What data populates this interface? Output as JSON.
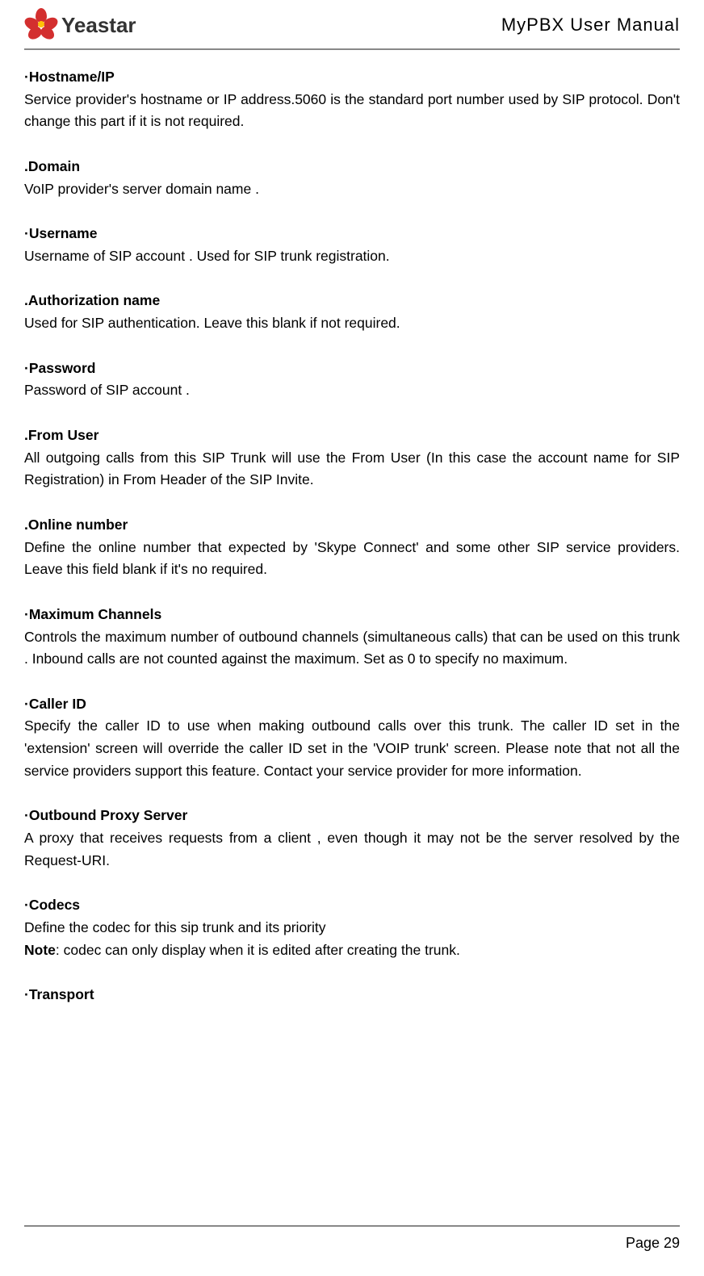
{
  "header": {
    "brand": "Yeastar",
    "doc_title": "MyPBX User Manual"
  },
  "sections": [
    {
      "title": "·Hostname/IP",
      "body": "Service provider's hostname or IP address.5060 is the standard port number used by SIP protocol. Don't change this part if it is not required."
    },
    {
      "title": ".Domain",
      "body": "VoIP provider's server domain name ."
    },
    {
      "title": "·Username",
      "body": "Username of SIP account . Used for SIP trunk registration."
    },
    {
      "title": ".Authorization name",
      "body": "Used for SIP authentication. Leave this blank if not required."
    },
    {
      "title": "·Password",
      "body": "Password of SIP account ."
    },
    {
      "title": ".From User",
      "body": "All outgoing calls from this SIP Trunk will use the From User (In this case the account name for SIP Registration) in From Header of the SIP Invite."
    },
    {
      "title": ".Online number",
      "body": "Define the online number that expected by 'Skype Connect' and some other SIP service providers. Leave this field blank if it's no required."
    },
    {
      "title": "·Maximum Channels",
      "body": "Controls the maximum number of outbound channels (simultaneous calls) that can be used on this trunk . Inbound calls are not counted against the maximum. Set as 0 to specify no maximum."
    },
    {
      "title": "·Caller ID",
      "body": "Specify the caller ID to use when making outbound calls over this trunk. The caller ID set in the 'extension' screen will override the caller ID set in the 'VOIP trunk' screen. Please note that not all the service providers support this feature. Contact your service provider for more information."
    },
    {
      "title": "·Outbound Proxy Server",
      "body": "A proxy that receives requests from a client , even though it may not be the server resolved by the Request-URI."
    },
    {
      "title": "·Codecs",
      "body": "Define the codec for this sip trunk and its priority",
      "note_label": "Note",
      "note_body": ": codec can only display when it is edited after creating the trunk."
    },
    {
      "title": "·Transport",
      "body": ""
    }
  ],
  "footer": {
    "page": "Page 29"
  }
}
